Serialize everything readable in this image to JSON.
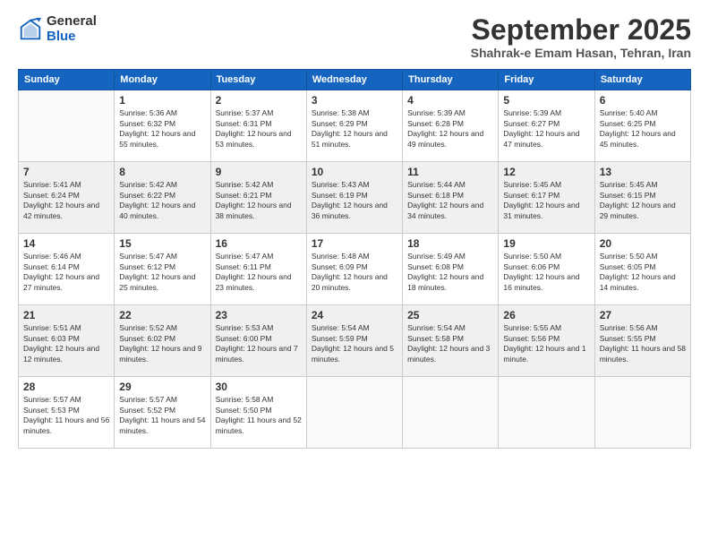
{
  "header": {
    "logo_general": "General",
    "logo_blue": "Blue",
    "month_title": "September 2025",
    "subtitle": "Shahrak-e Emam Hasan, Tehran, Iran"
  },
  "days_of_week": [
    "Sunday",
    "Monday",
    "Tuesday",
    "Wednesday",
    "Thursday",
    "Friday",
    "Saturday"
  ],
  "weeks": [
    [
      {
        "day": "",
        "empty": true
      },
      {
        "day": "1",
        "sunrise": "5:36 AM",
        "sunset": "6:32 PM",
        "daylight": "12 hours and 55 minutes."
      },
      {
        "day": "2",
        "sunrise": "5:37 AM",
        "sunset": "6:31 PM",
        "daylight": "12 hours and 53 minutes."
      },
      {
        "day": "3",
        "sunrise": "5:38 AM",
        "sunset": "6:29 PM",
        "daylight": "12 hours and 51 minutes."
      },
      {
        "day": "4",
        "sunrise": "5:39 AM",
        "sunset": "6:28 PM",
        "daylight": "12 hours and 49 minutes."
      },
      {
        "day": "5",
        "sunrise": "5:39 AM",
        "sunset": "6:27 PM",
        "daylight": "12 hours and 47 minutes."
      },
      {
        "day": "6",
        "sunrise": "5:40 AM",
        "sunset": "6:25 PM",
        "daylight": "12 hours and 45 minutes."
      }
    ],
    [
      {
        "day": "7",
        "sunrise": "5:41 AM",
        "sunset": "6:24 PM",
        "daylight": "12 hours and 42 minutes."
      },
      {
        "day": "8",
        "sunrise": "5:42 AM",
        "sunset": "6:22 PM",
        "daylight": "12 hours and 40 minutes."
      },
      {
        "day": "9",
        "sunrise": "5:42 AM",
        "sunset": "6:21 PM",
        "daylight": "12 hours and 38 minutes."
      },
      {
        "day": "10",
        "sunrise": "5:43 AM",
        "sunset": "6:19 PM",
        "daylight": "12 hours and 36 minutes."
      },
      {
        "day": "11",
        "sunrise": "5:44 AM",
        "sunset": "6:18 PM",
        "daylight": "12 hours and 34 minutes."
      },
      {
        "day": "12",
        "sunrise": "5:45 AM",
        "sunset": "6:17 PM",
        "daylight": "12 hours and 31 minutes."
      },
      {
        "day": "13",
        "sunrise": "5:45 AM",
        "sunset": "6:15 PM",
        "daylight": "12 hours and 29 minutes."
      }
    ],
    [
      {
        "day": "14",
        "sunrise": "5:46 AM",
        "sunset": "6:14 PM",
        "daylight": "12 hours and 27 minutes."
      },
      {
        "day": "15",
        "sunrise": "5:47 AM",
        "sunset": "6:12 PM",
        "daylight": "12 hours and 25 minutes."
      },
      {
        "day": "16",
        "sunrise": "5:47 AM",
        "sunset": "6:11 PM",
        "daylight": "12 hours and 23 minutes."
      },
      {
        "day": "17",
        "sunrise": "5:48 AM",
        "sunset": "6:09 PM",
        "daylight": "12 hours and 20 minutes."
      },
      {
        "day": "18",
        "sunrise": "5:49 AM",
        "sunset": "6:08 PM",
        "daylight": "12 hours and 18 minutes."
      },
      {
        "day": "19",
        "sunrise": "5:50 AM",
        "sunset": "6:06 PM",
        "daylight": "12 hours and 16 minutes."
      },
      {
        "day": "20",
        "sunrise": "5:50 AM",
        "sunset": "6:05 PM",
        "daylight": "12 hours and 14 minutes."
      }
    ],
    [
      {
        "day": "21",
        "sunrise": "5:51 AM",
        "sunset": "6:03 PM",
        "daylight": "12 hours and 12 minutes."
      },
      {
        "day": "22",
        "sunrise": "5:52 AM",
        "sunset": "6:02 PM",
        "daylight": "12 hours and 9 minutes."
      },
      {
        "day": "23",
        "sunrise": "5:53 AM",
        "sunset": "6:00 PM",
        "daylight": "12 hours and 7 minutes."
      },
      {
        "day": "24",
        "sunrise": "5:54 AM",
        "sunset": "5:59 PM",
        "daylight": "12 hours and 5 minutes."
      },
      {
        "day": "25",
        "sunrise": "5:54 AM",
        "sunset": "5:58 PM",
        "daylight": "12 hours and 3 minutes."
      },
      {
        "day": "26",
        "sunrise": "5:55 AM",
        "sunset": "5:56 PM",
        "daylight": "12 hours and 1 minute."
      },
      {
        "day": "27",
        "sunrise": "5:56 AM",
        "sunset": "5:55 PM",
        "daylight": "11 hours and 58 minutes."
      }
    ],
    [
      {
        "day": "28",
        "sunrise": "5:57 AM",
        "sunset": "5:53 PM",
        "daylight": "11 hours and 56 minutes."
      },
      {
        "day": "29",
        "sunrise": "5:57 AM",
        "sunset": "5:52 PM",
        "daylight": "11 hours and 54 minutes."
      },
      {
        "day": "30",
        "sunrise": "5:58 AM",
        "sunset": "5:50 PM",
        "daylight": "11 hours and 52 minutes."
      },
      {
        "day": "",
        "empty": true
      },
      {
        "day": "",
        "empty": true
      },
      {
        "day": "",
        "empty": true
      },
      {
        "day": "",
        "empty": true
      }
    ]
  ]
}
